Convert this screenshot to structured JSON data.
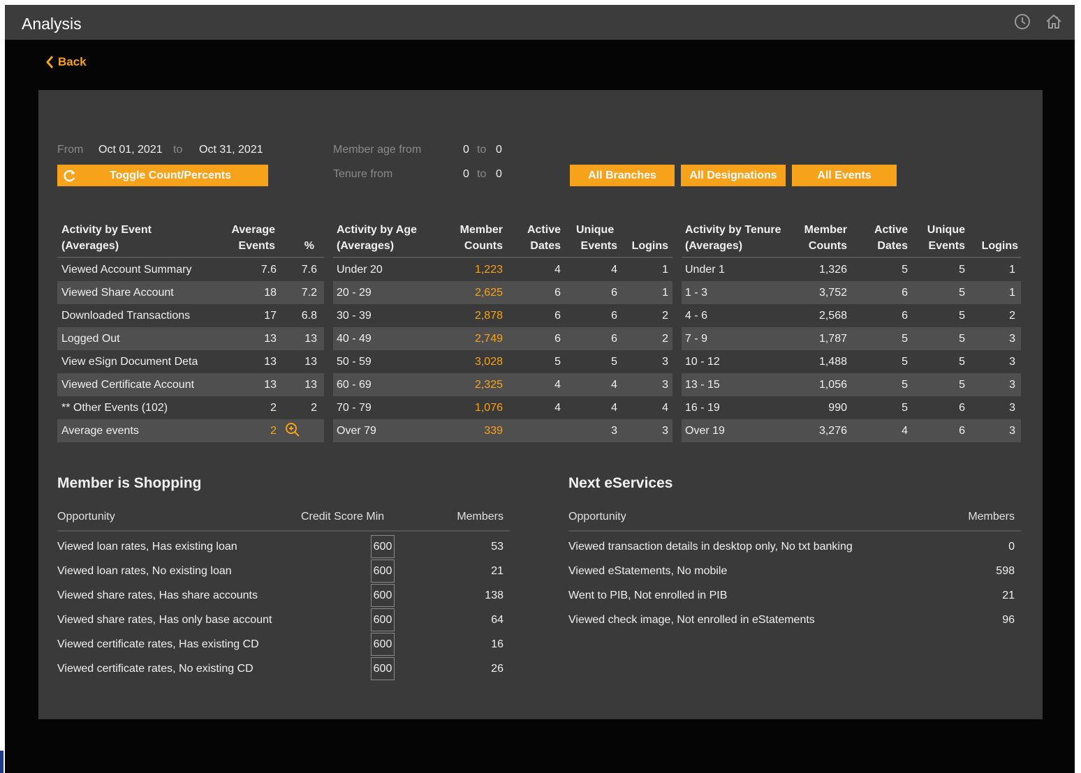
{
  "app": {
    "title": "Analysis",
    "back_label": "Back"
  },
  "colors": {
    "accent": "#f7a21b",
    "panel": "#3a3a3a",
    "row_shade": "#4f4f4f"
  },
  "filters": {
    "from_label": "From",
    "from_date": "Oct 01, 2021",
    "to_label": "to",
    "to_date": "Oct 31, 2021",
    "toggle_label": "Toggle Count/Percents",
    "age_label": "Member age from",
    "age_from": "0",
    "age_to_label": "to",
    "age_to": "0",
    "tenure_label": "Tenure from",
    "tenure_from": "0",
    "tenure_to_label": "to",
    "tenure_to": "0",
    "branches_label": "All Branches",
    "designations_label": "All Designations",
    "events_label": "All Events"
  },
  "event_table": {
    "h1a": "Activity by Event",
    "h1b": "(Averages)",
    "h2a": "Average",
    "h2b": "Events",
    "h3": "%",
    "rows": [
      {
        "name": "Viewed Account Summary",
        "avg": "7.6",
        "pct": "7.6"
      },
      {
        "name": "Viewed Share Account",
        "avg": "18",
        "pct": "7.2"
      },
      {
        "name": "Downloaded Transactions",
        "avg": "17",
        "pct": "6.8"
      },
      {
        "name": "Logged Out",
        "avg": "13",
        "pct": "13"
      },
      {
        "name": "View eSign Document Details",
        "avg": "13",
        "pct": "13"
      },
      {
        "name": "Viewed Certificate Account",
        "avg": "13",
        "pct": "13"
      },
      {
        "name": "** Other Events (102)",
        "avg": "2",
        "pct": "2"
      }
    ],
    "footer_label": "Average events",
    "footer_value": "2"
  },
  "age_table": {
    "h1a": "Activity by Age",
    "h1b": "(Averages)",
    "h2a": "Member",
    "h2b": "Counts",
    "h3a": "Active",
    "h3b": "Dates",
    "h4a": "Unique",
    "h4b": "Events",
    "h5": "Logins",
    "rows": [
      {
        "range": "Under 20",
        "count": "1,223",
        "dates": "4",
        "events": "4",
        "logins": "1"
      },
      {
        "range": "20 - 29",
        "count": "2,625",
        "dates": "6",
        "events": "6",
        "logins": "1"
      },
      {
        "range": "30 - 39",
        "count": "2,878",
        "dates": "6",
        "events": "6",
        "logins": "2"
      },
      {
        "range": "40 - 49",
        "count": "2,749",
        "dates": "6",
        "events": "6",
        "logins": "2"
      },
      {
        "range": "50 - 59",
        "count": "3,028",
        "dates": "5",
        "events": "5",
        "logins": "3"
      },
      {
        "range": "60 - 69",
        "count": "2,325",
        "dates": "4",
        "events": "4",
        "logins": "3"
      },
      {
        "range": "70 - 79",
        "count": "1,076",
        "dates": "4",
        "events": "4",
        "logins": "4"
      },
      {
        "range": "Over 79",
        "count": "339",
        "dates": "",
        "events": "3",
        "logins": "3"
      }
    ]
  },
  "tenure_table": {
    "h1a": "Activity by Tenure",
    "h1b": "(Averages)",
    "h2a": "Member",
    "h2b": "Counts",
    "h3a": "Active",
    "h3b": "Dates",
    "h4a": "Unique",
    "h4b": "Events",
    "h5": "Logins",
    "rows": [
      {
        "range": "Under 1",
        "count": "1,326",
        "dates": "5",
        "events": "5",
        "logins": "1"
      },
      {
        "range": "1 - 3",
        "count": "3,752",
        "dates": "6",
        "events": "5",
        "logins": "1"
      },
      {
        "range": "4 - 6",
        "count": "2,568",
        "dates": "6",
        "events": "5",
        "logins": "2"
      },
      {
        "range": "7 - 9",
        "count": "1,787",
        "dates": "5",
        "events": "5",
        "logins": "3"
      },
      {
        "range": "10 - 12",
        "count": "1,488",
        "dates": "5",
        "events": "5",
        "logins": "3"
      },
      {
        "range": "13 - 15",
        "count": "1,056",
        "dates": "5",
        "events": "5",
        "logins": "3"
      },
      {
        "range": "16 - 19",
        "count": "990",
        "dates": "5",
        "events": "6",
        "logins": "3"
      },
      {
        "range": "Over 19",
        "count": "3,276",
        "dates": "4",
        "events": "6",
        "logins": "3"
      }
    ]
  },
  "shopping": {
    "title": "Member is Shopping",
    "col_opportunity": "Opportunity",
    "col_credit": "Credit Score Min",
    "col_members": "Members",
    "rows": [
      {
        "opportunity": "Viewed loan rates, Has existing loan",
        "score": "600",
        "members": "53"
      },
      {
        "opportunity": "Viewed loan rates, No existing loan",
        "score": "600",
        "members": "21"
      },
      {
        "opportunity": "Viewed share rates, Has share accounts",
        "score": "600",
        "members": "138"
      },
      {
        "opportunity": "Viewed share rates, Has only base account",
        "score": "600",
        "members": "64"
      },
      {
        "opportunity": "Viewed certificate rates, Has existing CD",
        "score": "600",
        "members": "16"
      },
      {
        "opportunity": "Viewed certificate rates, No existing CD",
        "score": "600",
        "members": "26"
      }
    ]
  },
  "eservices": {
    "title": "Next eServices",
    "col_opportunity": "Opportunity",
    "col_members": "Members",
    "rows": [
      {
        "opportunity": "Viewed transaction details in desktop only, No txt banking",
        "members": "0"
      },
      {
        "opportunity": "Viewed eStatements, No mobile",
        "members": "598"
      },
      {
        "opportunity": "Went to PIB, Not enrolled in PIB",
        "members": "21"
      },
      {
        "opportunity": "Viewed check image, Not enrolled in eStatements",
        "members": "96"
      }
    ]
  }
}
